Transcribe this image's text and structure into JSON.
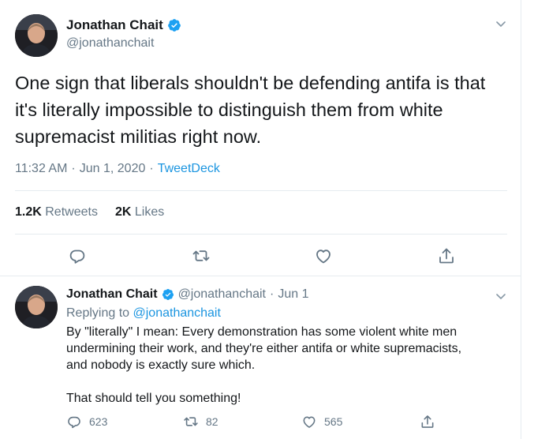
{
  "main_tweet": {
    "author_name": "Jonathan Chait",
    "handle": "@jonathanchait",
    "text": "One sign that liberals shouldn't be defending antifa is that it's literally impossible to distinguish them from white supremacist militias right now.",
    "time": "11:32 AM",
    "date": "Jun 1, 2020",
    "source": "TweetDeck",
    "retweets_count": "1.2K",
    "retweets_label": "Retweets",
    "likes_count": "2K",
    "likes_label": "Likes"
  },
  "reply_tweet": {
    "author_name": "Jonathan Chait",
    "handle": "@jonathanchait",
    "date": "Jun 1",
    "replying_label": "Replying to",
    "replying_to": "@jonathanchait",
    "paragraph_1_line_1": "By \"literally\" I mean: Every demonstration has some violent white men",
    "paragraph_1_line_2": "undermining their work, and they're either antifa or white supremacists,",
    "paragraph_1_line_3": "and nobody is exactly sure which.",
    "paragraph_2": "That should tell you something!",
    "reply_count": "623",
    "retweet_count": "82",
    "like_count": "565"
  },
  "colors": {
    "text": "#14171a",
    "secondary": "#657786",
    "link": "#1b95e0",
    "verified": "#1da1f2",
    "border": "#e6ecf0"
  },
  "icons": {
    "verified": "verified-badge-icon",
    "chevron": "chevron-down-icon",
    "reply": "reply-icon",
    "retweet": "retweet-icon",
    "like": "heart-icon",
    "share": "share-icon"
  }
}
